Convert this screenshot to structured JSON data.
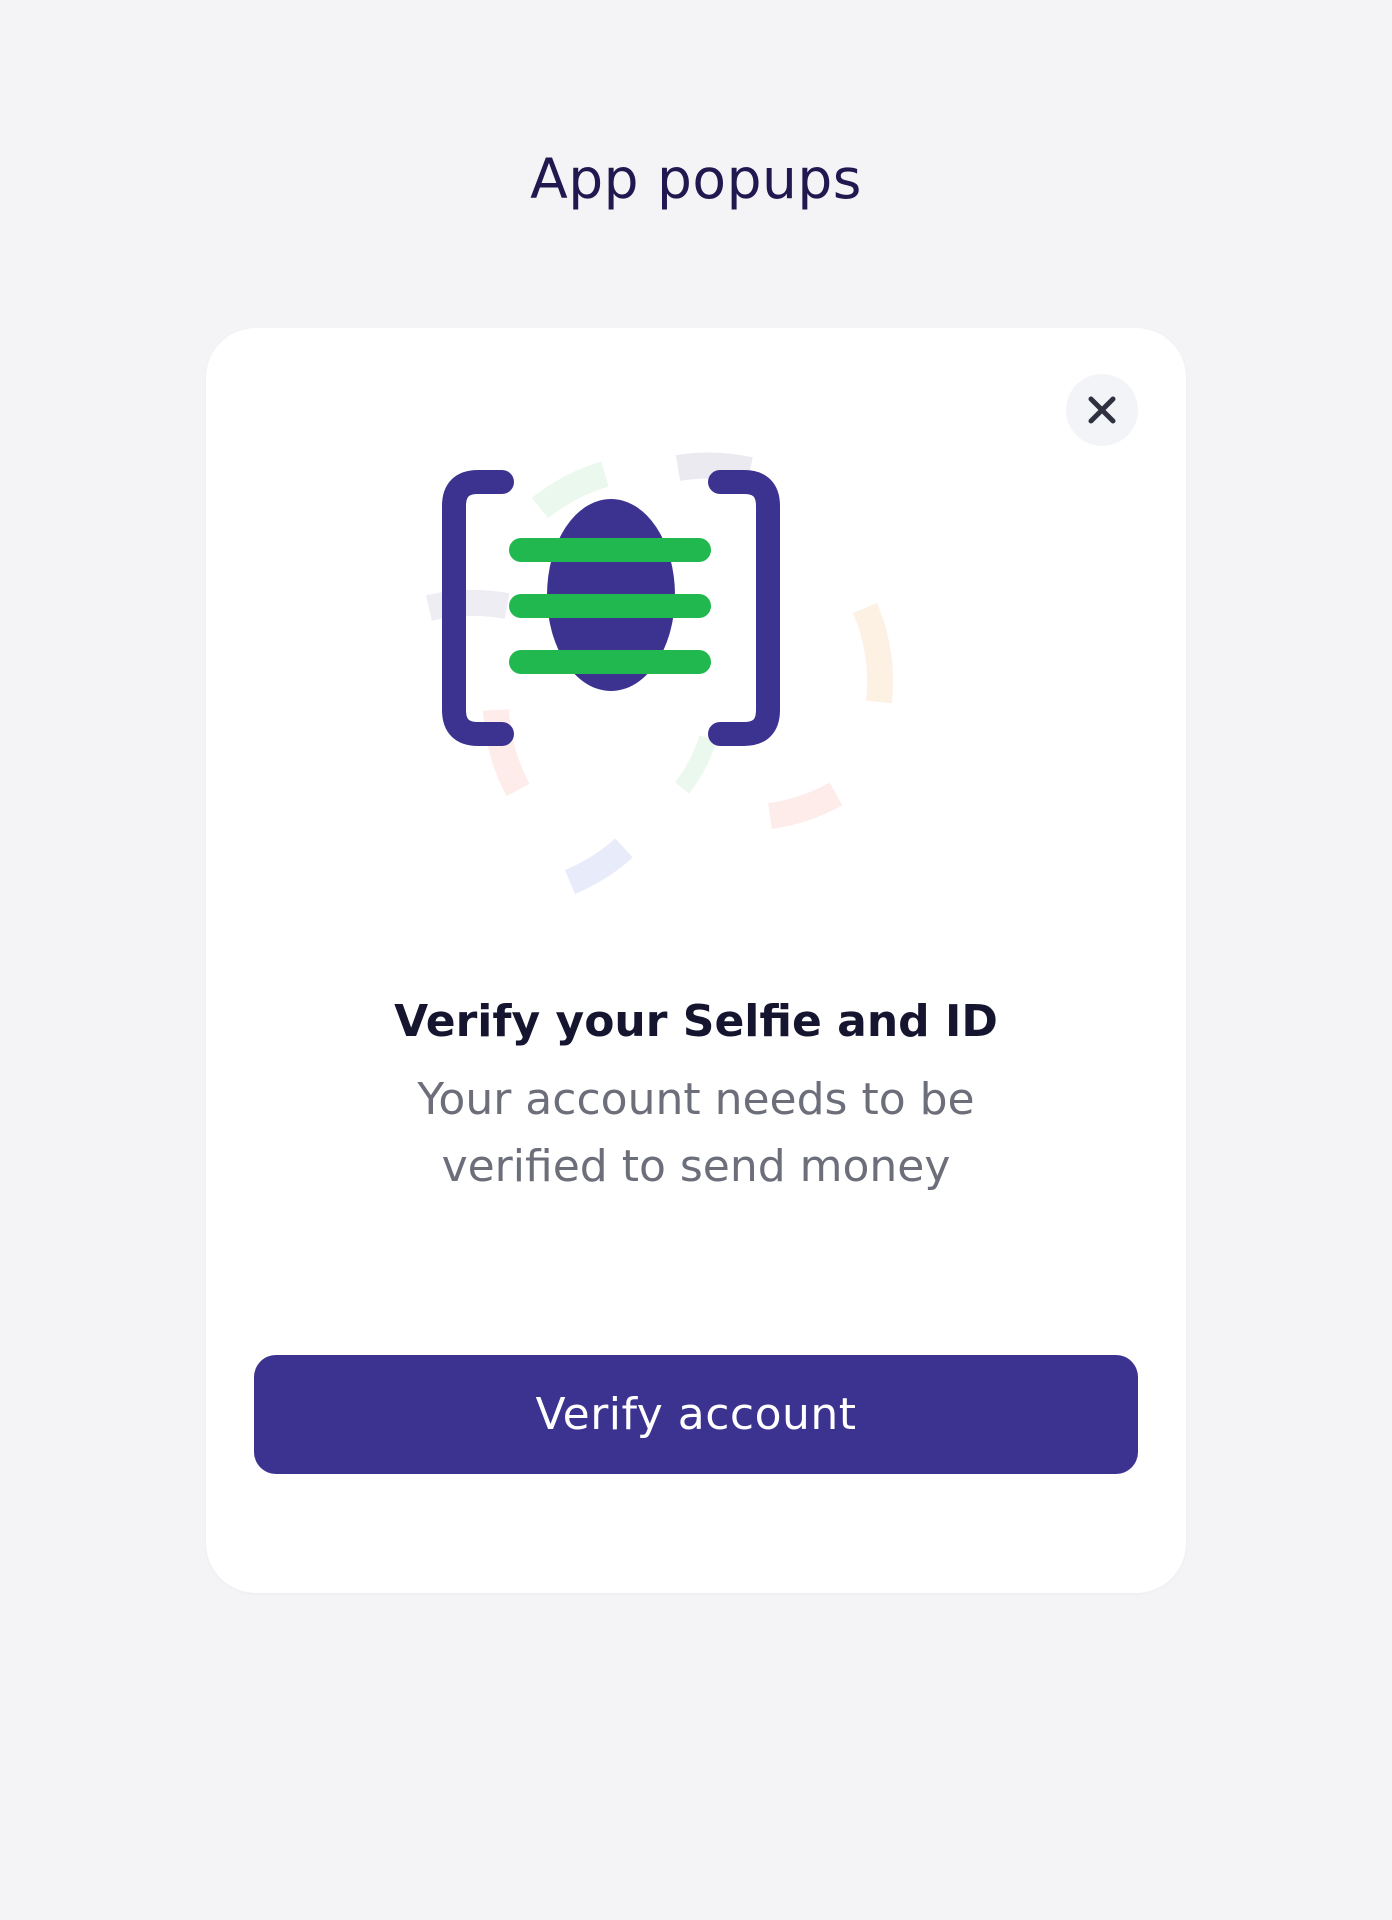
{
  "page": {
    "title": "App popups"
  },
  "popup": {
    "close_icon": "close-icon",
    "illustration_icon": "face-scan-icon",
    "heading": "Verify your Selfie and ID",
    "message": "Your account needs to be verified to send money",
    "primary_button_label": "Verify account"
  },
  "colors": {
    "page_background": "#f4f3f6",
    "card_background": "#ffffff",
    "brand_primary": "#3c3391",
    "accent_green": "#20b84f",
    "heading_text": "#151530",
    "body_text": "#6c6e7a",
    "title_text": "#20184f"
  }
}
